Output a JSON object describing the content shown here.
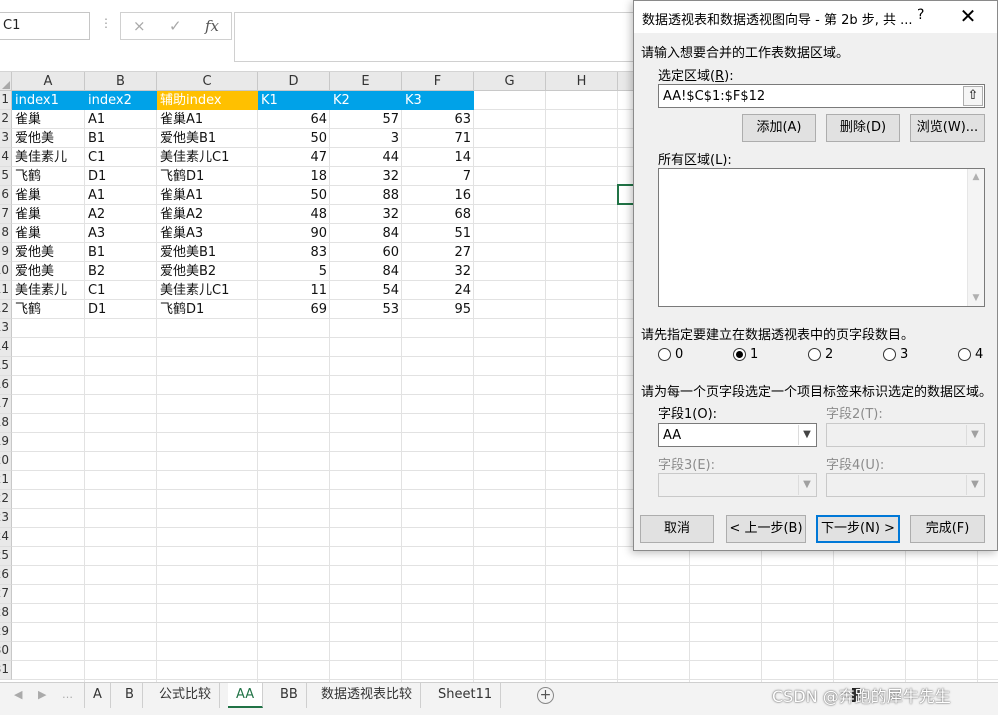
{
  "formula_bar": {
    "name_box": "C1",
    "cancel_icon": "×",
    "enter_icon": "✓",
    "fx_icon": "fx",
    "formula": ""
  },
  "columns": [
    "A",
    "B",
    "C",
    "D",
    "E",
    "F",
    "G",
    "H"
  ],
  "row_numbers": [
    "1",
    "2",
    "3",
    "4",
    "5",
    "6",
    "7",
    "8",
    "9",
    "10",
    "11",
    "12",
    "13",
    "14",
    "15",
    "16",
    "17",
    "18",
    "19",
    "20",
    "21",
    "22",
    "23",
    "24",
    "25",
    "26",
    "27",
    "28",
    "29",
    "30",
    "31"
  ],
  "header_row": {
    "index1": "index1",
    "index2": "index2",
    "aux_index": "辅助index",
    "k1": "K1",
    "k2": "K2",
    "k3": "K3"
  },
  "rows": [
    [
      "雀巢",
      "A1",
      "雀巢A1",
      "64",
      "57",
      "63"
    ],
    [
      "爱他美",
      "B1",
      "爱他美B1",
      "50",
      "3",
      "71"
    ],
    [
      "美佳素儿",
      "C1",
      "美佳素儿C1",
      "47",
      "44",
      "14"
    ],
    [
      "飞鹤",
      "D1",
      "飞鹤D1",
      "18",
      "32",
      "7"
    ],
    [
      "雀巢",
      "A1",
      "雀巢A1",
      "50",
      "88",
      "16"
    ],
    [
      "雀巢",
      "A2",
      "雀巢A2",
      "48",
      "32",
      "68"
    ],
    [
      "雀巢",
      "A3",
      "雀巢A3",
      "90",
      "84",
      "51"
    ],
    [
      "爱他美",
      "B1",
      "爱他美B1",
      "83",
      "60",
      "27"
    ],
    [
      "爱他美",
      "B2",
      "爱他美B2",
      "5",
      "84",
      "32"
    ],
    [
      "美佳素儿",
      "C1",
      "美佳素儿C1",
      "11",
      "54",
      "24"
    ],
    [
      "飞鹤",
      "D1",
      "飞鹤D1",
      "69",
      "53",
      "95"
    ]
  ],
  "sheet_tabs": [
    "A",
    "B",
    "公式比较",
    "AA",
    "BB",
    "数据透视表比较",
    "Sheet11"
  ],
  "active_tab": "AA",
  "watermark": "CSDN @奔跑的犀牛先生",
  "dialog": {
    "title": "数据透视表和数据透视图向导 - 第 2b 步, 共 ...",
    "help": "?",
    "close": "✕",
    "prompt": "请输入想要合并的工作表数据区域。",
    "range_label_pre": "选定区域(",
    "range_label_key": "R",
    "range_label_post": "):",
    "range_value": "AA!$C$1:$F$12",
    "add_button": "添加(A)",
    "delete_button": "删除(D)",
    "browse_button": "浏览(W)...",
    "all_ranges_label": "所有区域(L):",
    "page_fields_prompt": "请先指定要建立在数据透视表中的页字段数目。",
    "radio_options": [
      "0",
      "1",
      "2",
      "3",
      "4"
    ],
    "radio_selected": "1",
    "label_prompt": "请为每一个页字段选定一个项目标签来标识选定的数据区域。",
    "field1_label": "字段1(O):",
    "field1_value": "AA",
    "field2_label": "字段2(T):",
    "field3_label": "字段3(E):",
    "field4_label": "字段4(U):",
    "cancel_button": "取消",
    "back_button": "< 上一步(B)",
    "next_button": "下一步(N) >",
    "finish_button": "完成(F)"
  },
  "colors": {
    "header_blue": "#00a2e8",
    "header_orange": "#ffc000",
    "excel_green": "#217346",
    "dialog_bg": "#f0f0f0"
  }
}
